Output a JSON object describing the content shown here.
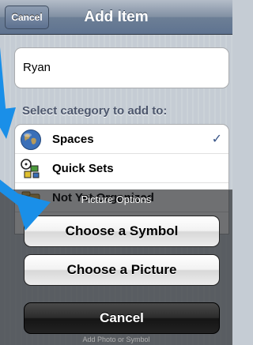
{
  "navbar": {
    "title": "Add Item",
    "cancel_label": "Cancel"
  },
  "form": {
    "name_value": "Ryan",
    "category_header": "Select category to add to:"
  },
  "categories": [
    {
      "label": "Spaces",
      "icon": "globe-icon",
      "selected": true,
      "check": "✓"
    },
    {
      "label": "Quick Sets",
      "icon": "quick-sets-icon",
      "selected": false,
      "check": ""
    },
    {
      "label": "Not Yet Organized",
      "icon": "folder-icon",
      "selected": false,
      "check": ""
    }
  ],
  "action_sheet": {
    "title": "Picture Options",
    "choose_symbol_label": "Choose a Symbol",
    "choose_picture_label": "Choose a Picture",
    "cancel_label": "Cancel",
    "footer_text": "Add Photo or Symbol"
  },
  "colors": {
    "arrow": "#1a8fe8",
    "navbar": "#6d7f96",
    "check": "#385487"
  }
}
